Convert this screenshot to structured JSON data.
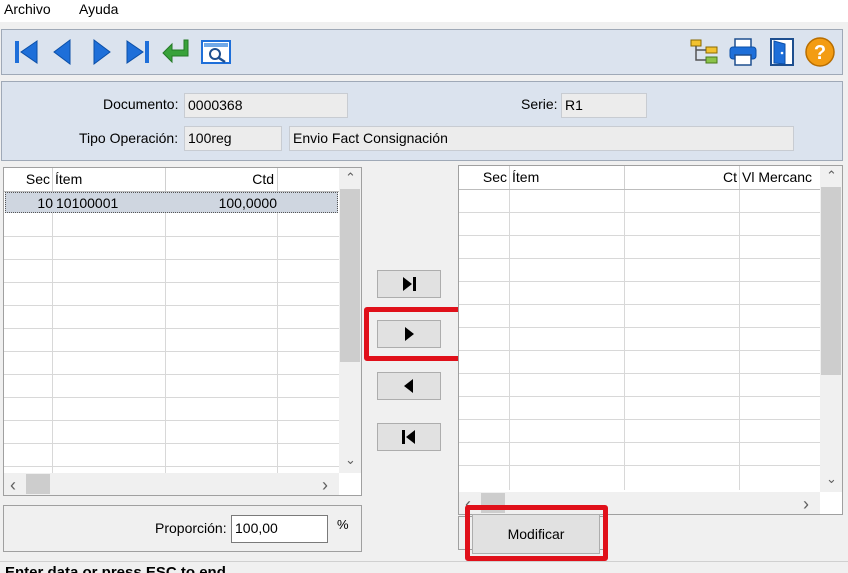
{
  "menu": {
    "archivo": "Archivo",
    "ayuda": "Ayuda"
  },
  "toolbar": {
    "icons": [
      "first-record-icon",
      "previous-record-icon",
      "next-record-icon",
      "last-record-icon",
      "enter-icon",
      "preview-icon",
      "tree-icon",
      "print-icon",
      "exit-door-icon",
      "help-icon"
    ],
    "help_glyph": "?"
  },
  "header": {
    "documento_label": "Documento:",
    "documento_value": "0000368",
    "serie_label": "Serie:",
    "serie_value": "R1",
    "tipo_label": "Tipo Operación:",
    "tipo_code": "100reg",
    "tipo_desc": "Envio Fact Consignación"
  },
  "left_grid": {
    "columns": {
      "sec": "Sec",
      "item": "Ítem",
      "ctd": "Ctd"
    },
    "rows": [
      {
        "sec": "10",
        "item": "10100001",
        "ctd": "100,0000"
      }
    ]
  },
  "right_grid": {
    "columns": {
      "sec": "Sec",
      "item": "Ítem",
      "ct": "Ct",
      "vl": "Vl Mercanc"
    }
  },
  "proportion": {
    "label": "Proporción:",
    "value": "100,00",
    "unit": "%"
  },
  "modify_button": "Modificar",
  "status": "Enter data or press ESC to end",
  "scroll_glyphs": {
    "up": "⌃",
    "down": "⌄",
    "left": "‹",
    "right": "›"
  },
  "colors": {
    "highlight": "#e0101a",
    "icon_blue": "#1e6fd9",
    "icon_green": "#39a23a",
    "help_orange": "#f39c12"
  }
}
